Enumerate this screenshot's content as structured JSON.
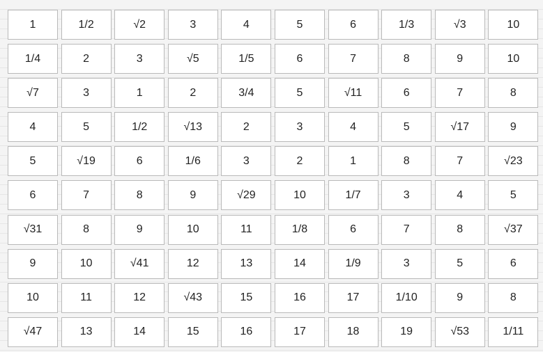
{
  "grid": {
    "rows": [
      [
        "1",
        "1/2",
        "√2",
        "3",
        "4",
        "5",
        "6",
        "1/3",
        "√3",
        "10"
      ],
      [
        "1/4",
        "2",
        "3",
        "√5",
        "1/5",
        "6",
        "7",
        "8",
        "9",
        "10"
      ],
      [
        "√7",
        "3",
        "1",
        "2",
        "3/4",
        "5",
        "√11",
        "6",
        "7",
        "8"
      ],
      [
        "4",
        "5",
        "1/2",
        "√13",
        "2",
        "3",
        "4",
        "5",
        "√17",
        "9"
      ],
      [
        "5",
        "√19",
        "6",
        "1/6",
        "3",
        "2",
        "1",
        "8",
        "7",
        "√23"
      ],
      [
        "6",
        "7",
        "8",
        "9",
        "√29",
        "10",
        "1/7",
        "3",
        "4",
        "5"
      ],
      [
        "√31",
        "8",
        "9",
        "10",
        "11",
        "1/8",
        "6",
        "7",
        "8",
        "√37"
      ],
      [
        "9",
        "10",
        "√41",
        "12",
        "13",
        "14",
        "1/9",
        "3",
        "5",
        "6"
      ],
      [
        "10",
        "11",
        "12",
        "√43",
        "15",
        "16",
        "17",
        "1/10",
        "9",
        "8"
      ],
      [
        "√47",
        "13",
        "14",
        "15",
        "16",
        "17",
        "18",
        "19",
        "√53",
        "1/11"
      ]
    ]
  }
}
